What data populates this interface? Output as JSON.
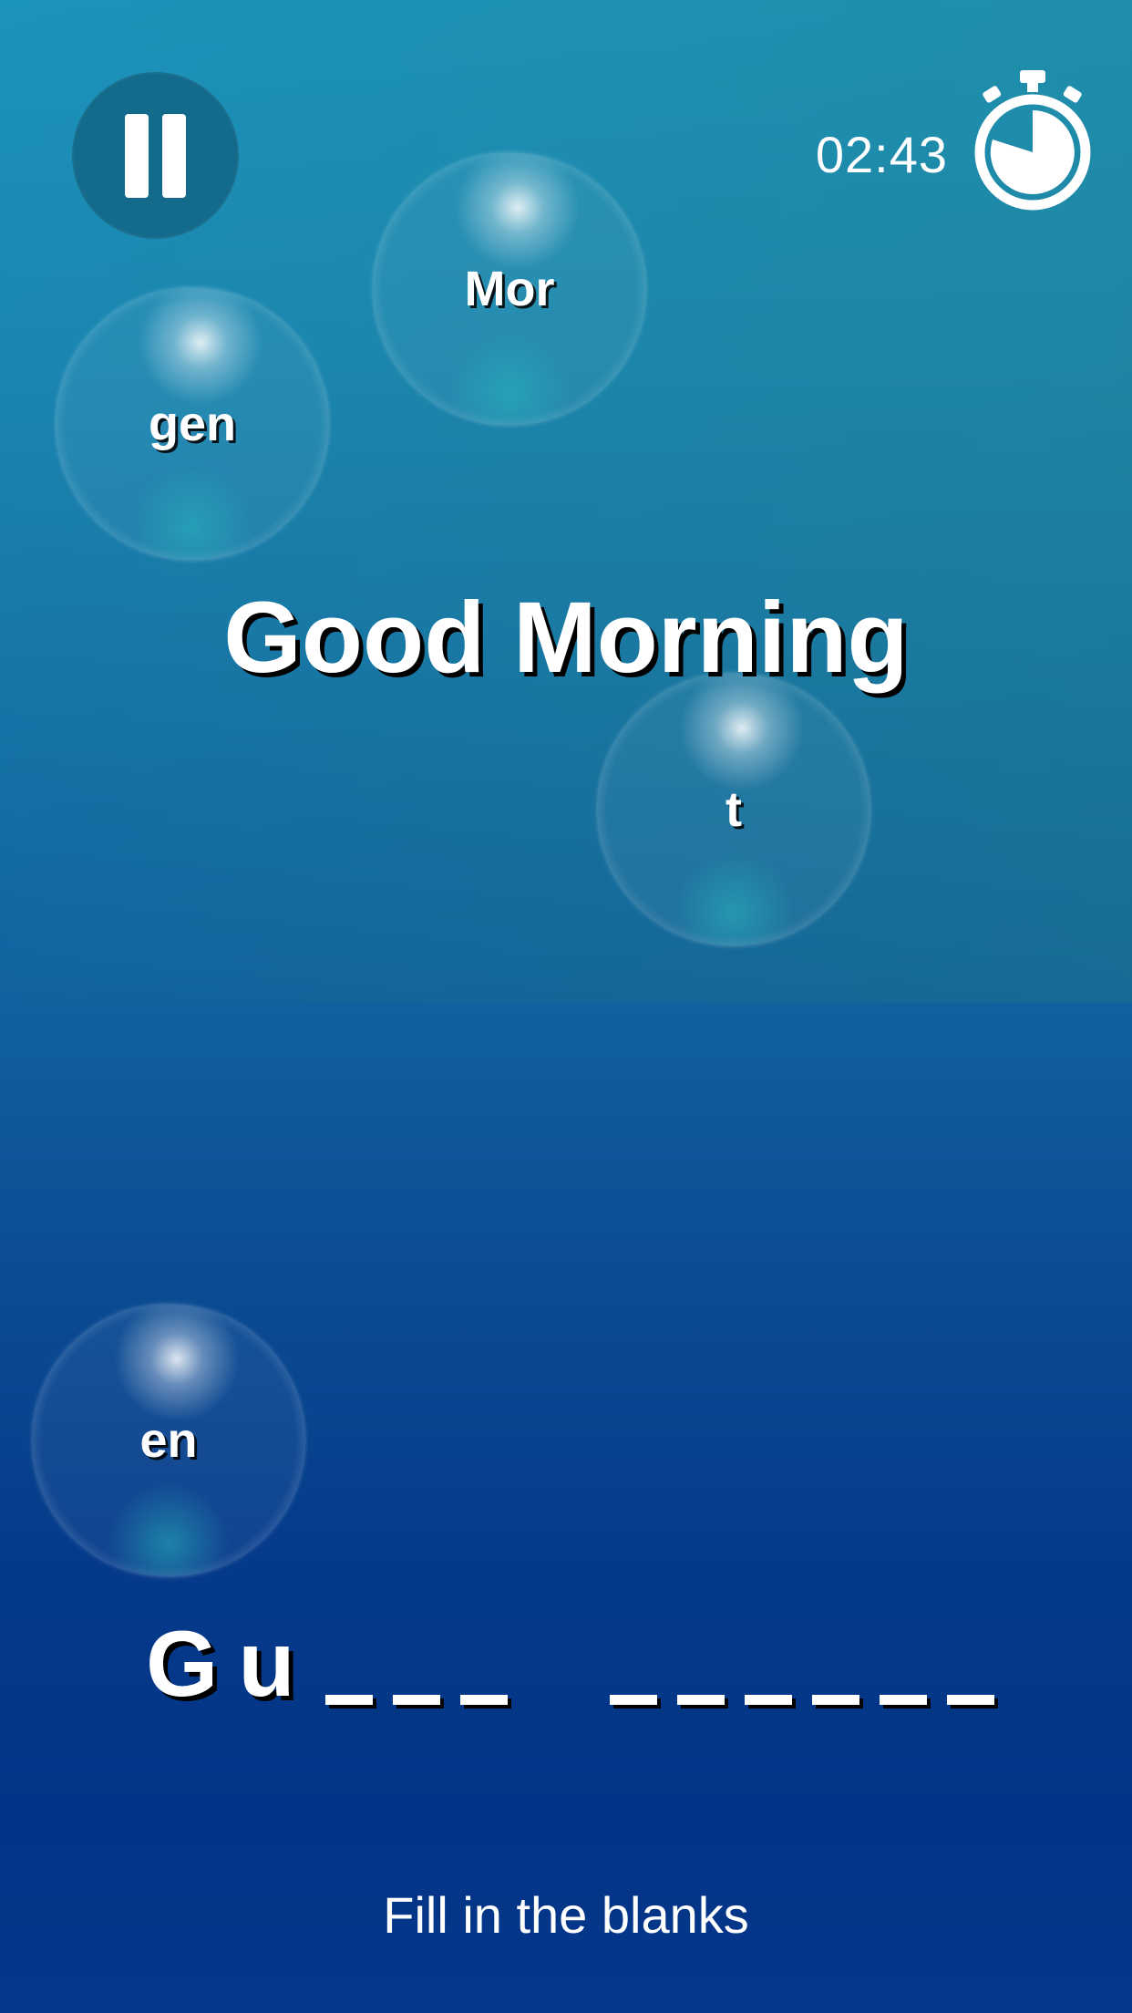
{
  "hud": {
    "timer": "02:43"
  },
  "icons": {
    "pause": "pause-icon",
    "stopwatch": "stopwatch-icon"
  },
  "colors": {
    "pause_button_bg": "#136a8a",
    "background_top": "#1c93bc",
    "background_bottom": "#043487"
  },
  "bubbles": [
    {
      "label": "Mor"
    },
    {
      "label": "gen"
    },
    {
      "label": "t"
    },
    {
      "label": "en"
    }
  ],
  "target_word": "Good Morning",
  "answer": {
    "letters": [
      "G",
      "u"
    ],
    "first_word_blanks": 3,
    "second_word_blanks": 6
  },
  "instruction": "Fill in the blanks"
}
